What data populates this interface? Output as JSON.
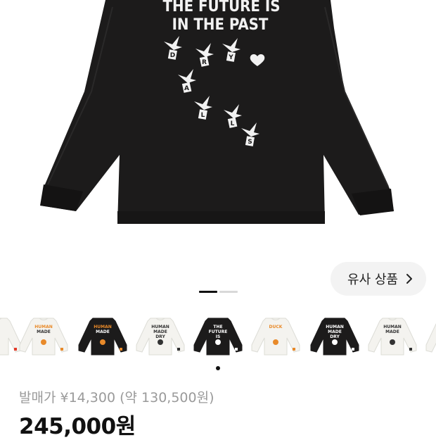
{
  "hero": {
    "print_line1": "THE FUTURE IS",
    "print_line2": "IN THE PAST",
    "duck_letters": [
      "D",
      "R",
      "Y",
      "A",
      "L",
      "L",
      "S"
    ],
    "shirt_color": "#1c1b1b"
  },
  "similar_button": {
    "label": "유사 상품",
    "icon": "chevron-right-icon"
  },
  "pager": {
    "total": 2,
    "active": 1
  },
  "thumbnails": [
    {
      "style": "white",
      "print": "",
      "accent": "#e43b2a"
    },
    {
      "style": "white",
      "print": "HUMAN MADE",
      "accent": "#e88a2a"
    },
    {
      "style": "black",
      "print": "HUMAN MADE",
      "accent": "#e88a2a"
    },
    {
      "style": "white",
      "print": "HUMAN MADE DRY ALLS",
      "accent": "#333333"
    },
    {
      "style": "black",
      "print": "THE FUTURE IS IN THE PAST",
      "accent": "#ffffff"
    },
    {
      "style": "white",
      "print": "DUCK",
      "accent": "#e88a2a"
    },
    {
      "style": "black",
      "print": "HUMAN MADE DRY ALLS",
      "accent": "#ffffff"
    },
    {
      "style": "white",
      "print": "HUMAN MADE",
      "accent": "#333333"
    },
    {
      "style": "white",
      "print": "",
      "accent": "#e43b2a"
    }
  ],
  "carousel": {
    "dot_count": 1
  },
  "price_info": {
    "release_price": "발매가 ¥14,300 (약 130,500원)",
    "current_price": "245,000원"
  }
}
